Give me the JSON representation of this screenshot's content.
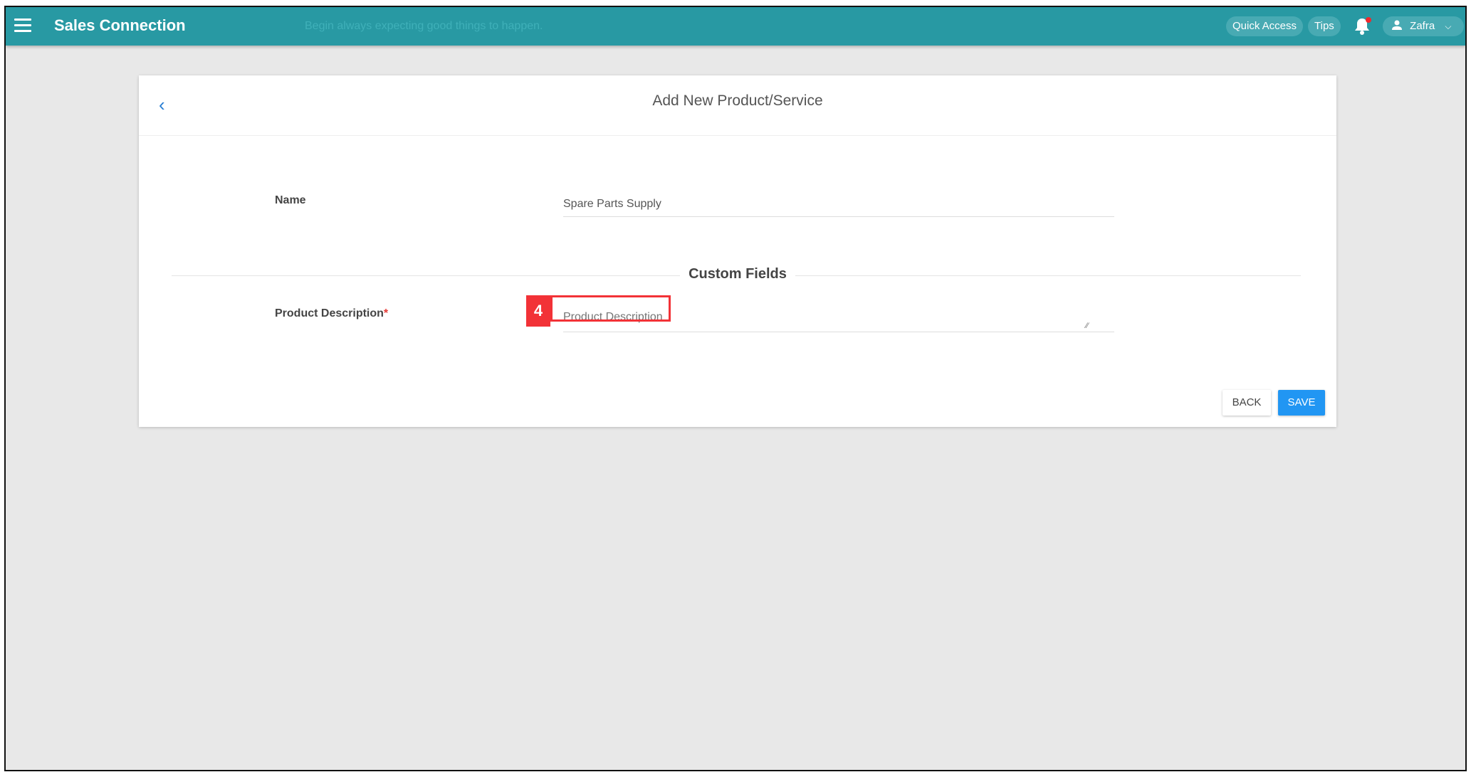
{
  "topbar": {
    "app_title": "Sales Connection",
    "quote": "Begin always expecting good things to happen.",
    "quick_access": "Quick Access",
    "tips": "Tips",
    "user_name": "Zafra",
    "color": "#2899a3"
  },
  "form": {
    "title": "Add New Product/Service",
    "name_label": "Name",
    "name_value": "Spare Parts Supply",
    "custom_fields_heading": "Custom Fields",
    "description_label": "Product Description",
    "required_mark": "*",
    "description_placeholder": "Product Description",
    "back_label": "BACK",
    "save_label": "SAVE"
  },
  "annotation": {
    "number": "4",
    "color": "#f23237"
  }
}
